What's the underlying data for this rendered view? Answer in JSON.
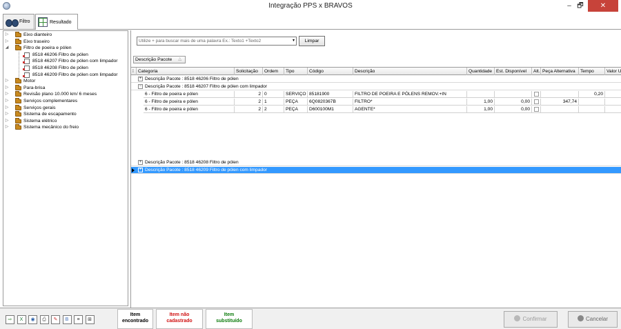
{
  "window": {
    "title": "Integração PPS x BRAVOS",
    "min": "–",
    "max": "🗗",
    "close": "✕"
  },
  "tabs": [
    {
      "label": "Filtro"
    },
    {
      "label": "Resultado"
    }
  ],
  "tree": {
    "items": [
      {
        "label": "Eixo dianteiro",
        "level": 0,
        "toggle": "▷",
        "icon": "folder"
      },
      {
        "label": "Eixo traseiro",
        "level": 0,
        "toggle": "▷",
        "icon": "folder"
      },
      {
        "label": "Filtro de poeira e pólen",
        "level": 0,
        "toggle": "◢",
        "icon": "folder"
      },
      {
        "label": "8518 46206  Filtro de pólen",
        "level": 1,
        "toggle": "",
        "icon": "doc"
      },
      {
        "label": "8518 46207  Filtro de pólen com limpador",
        "level": 1,
        "toggle": "",
        "icon": "doc"
      },
      {
        "label": "8518 46208  Filtro de pólen",
        "level": 1,
        "toggle": "",
        "icon": "doc"
      },
      {
        "label": "8518 46209  Filtro de pólen com limpador",
        "level": 1,
        "toggle": "",
        "icon": "doc"
      },
      {
        "label": "Motor",
        "level": 0,
        "toggle": "▷",
        "icon": "folder"
      },
      {
        "label": "Para-brisa",
        "level": 0,
        "toggle": "▷",
        "icon": "folder"
      },
      {
        "label": "Revisão plano 10.000 km/ 6 meses",
        "level": 0,
        "toggle": "▷",
        "icon": "folder"
      },
      {
        "label": "Serviços complementares",
        "level": 0,
        "toggle": "▷",
        "icon": "folder"
      },
      {
        "label": "Serviços gerais",
        "level": 0,
        "toggle": "▷",
        "icon": "folder"
      },
      {
        "label": "Sistema de escapamento",
        "level": 0,
        "toggle": "▷",
        "icon": "folder"
      },
      {
        "label": "Sistema elétrico",
        "level": 0,
        "toggle": "▷",
        "icon": "folder"
      },
      {
        "label": "Sistema mecânico do freio",
        "level": 0,
        "toggle": "▷",
        "icon": "folder"
      }
    ]
  },
  "search": {
    "placeholder": "Utilize + para buscar mais de uma palavra Ex.: Texto1 +Texto2",
    "dropdown": "▾",
    "clear_label": "Limpar"
  },
  "group_chip": {
    "label": "Descrição Pacote",
    "sort": "△"
  },
  "grid": {
    "columns": [
      "Categoria",
      "Solicitação",
      "Ordem",
      "Tipo",
      "Código",
      "Descrição",
      "Quantidade",
      "Est. Disponível",
      "Alt.",
      "Peça Alternativa",
      "Tempo",
      "Valor U"
    ],
    "groups": [
      {
        "label": "Descrição Pacote : 8518 46206  Filtro de pólen",
        "toggle": "+"
      },
      {
        "label": "Descrição Pacote : 8518 46207  Filtro de pólen com limpador",
        "toggle": "−"
      },
      {
        "label": "Descrição Pacote : 8518 46208  Filtro de pólen",
        "toggle": "+"
      },
      {
        "label": "Descrição Pacote : 8518 46209  Filtro de pólen com limpador",
        "toggle": "+"
      }
    ],
    "rows": [
      {
        "categoria": "6 - Filtro de poeira e pólen",
        "solicitacao": "2",
        "ordem": "0",
        "tipo": "SERVIÇO",
        "codigo": "85181900",
        "descricao": "FILTRO DE POEIRA E PÓLENS REMOV.+IN",
        "quantidade": "",
        "est": "",
        "peca_alt": "",
        "tempo": "0,20"
      },
      {
        "categoria": "6 - Filtro de poeira e pólen",
        "solicitacao": "2",
        "ordem": "1",
        "tipo": "PEÇA",
        "codigo": "6Q0820367B",
        "descricao": "FILTRO*",
        "quantidade": "1,00",
        "est": "0,00",
        "peca_alt": "347,74",
        "tempo": ""
      },
      {
        "categoria": "6 - Filtro de poeira e pólen",
        "solicitacao": "2",
        "ordem": "2",
        "tipo": "PEÇA",
        "codigo": "D600100M1",
        "descricao": "AGENTE*",
        "quantidade": "1,00",
        "est": "0,00",
        "peca_alt": "",
        "tempo": ""
      }
    ]
  },
  "scrollbar": {
    "left": "◀",
    "right": "▶"
  },
  "toolbar": {
    "icons": [
      "⇨",
      "X",
      "◉",
      "⎙",
      "✎",
      "B",
      "≡",
      "⊞"
    ]
  },
  "legend": [
    {
      "line1": "Item",
      "line2": "encontrado",
      "color": "#000000"
    },
    {
      "line1": "Item não",
      "line2": "cadastrado",
      "color": "#d01010"
    },
    {
      "line1": "Item",
      "line2": "substituído",
      "color": "#0a7a0a"
    }
  ],
  "actions": {
    "confirm": "Confirmar",
    "cancel": "Cancelar"
  }
}
